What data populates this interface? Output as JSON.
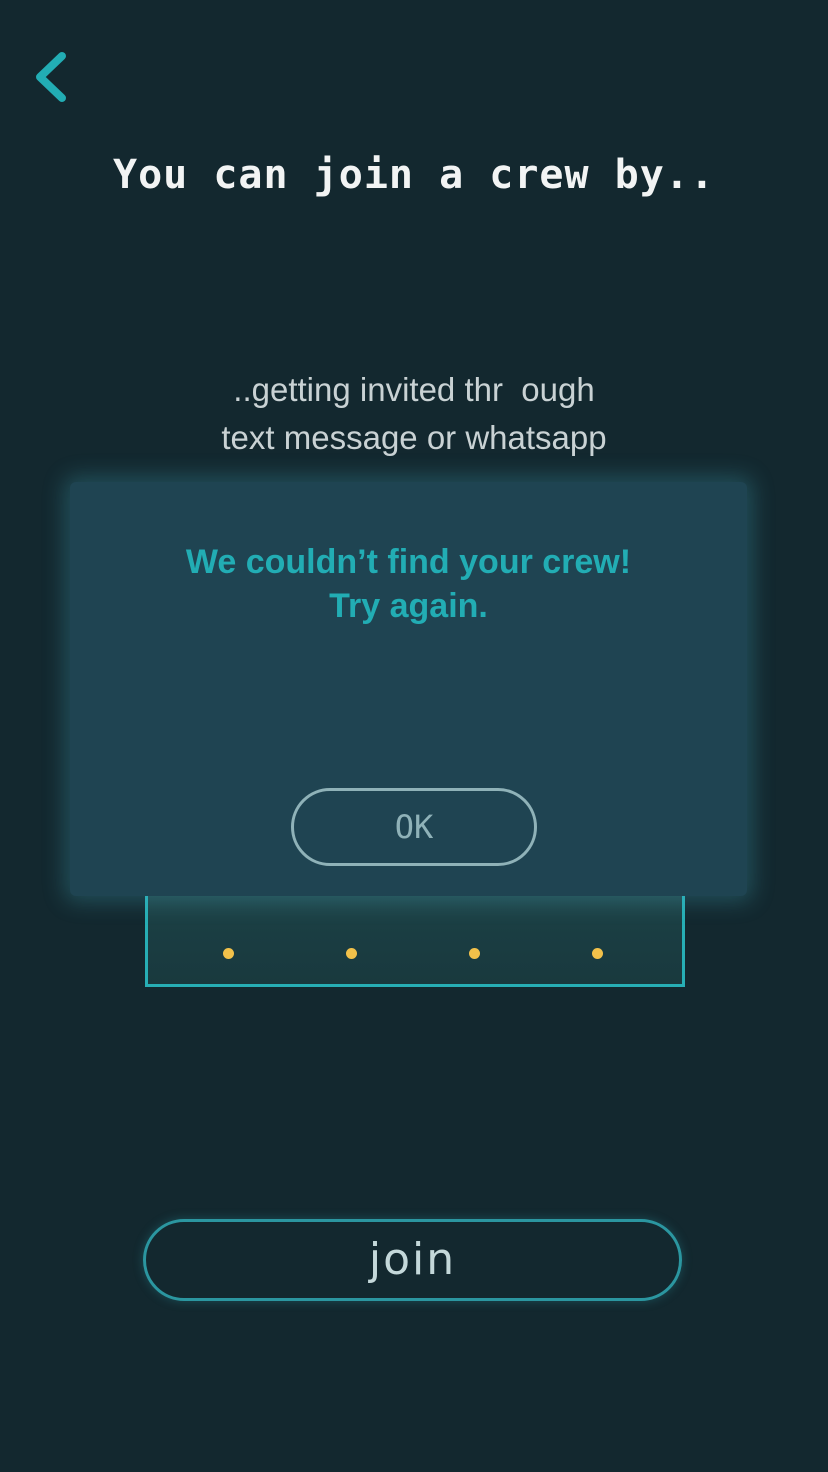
{
  "header": {
    "back_icon": "chevron-left-icon",
    "title": "You can join a crew by.."
  },
  "subtitle": {
    "line1": "..getting invited thr  ough",
    "line2": "text message or whatsapp"
  },
  "code_entry": {
    "digit_count": 4,
    "placeholder_dot_color": "#f2c14a"
  },
  "dialog": {
    "message_line1": "We couldn’t find your crew!",
    "message_line2": "Try again.",
    "ok_label": "OK"
  },
  "footer": {
    "join_label": "join"
  },
  "colors": {
    "background": "#13282f",
    "accent": "#22adb4",
    "dialog_bg": "#1f4452"
  }
}
